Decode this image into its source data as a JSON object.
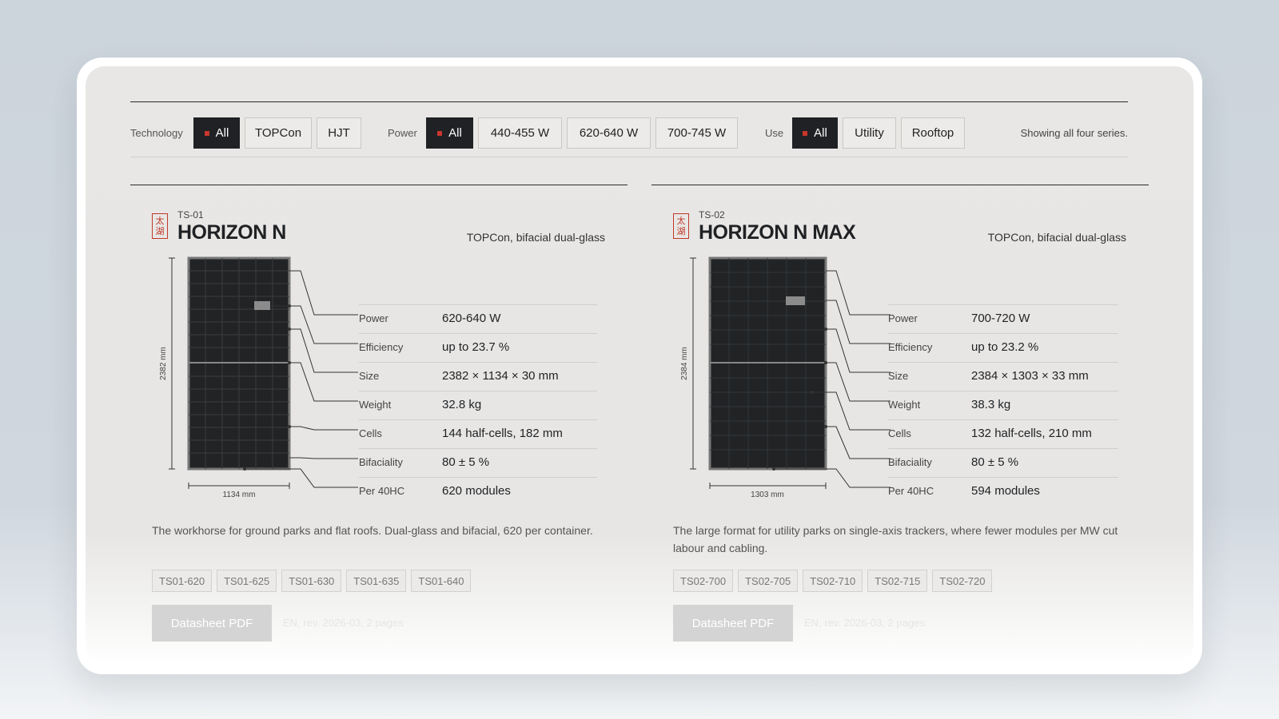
{
  "filters": {
    "technology": {
      "label": "Technology",
      "options": [
        "All",
        "TOPCon",
        "HJT"
      ],
      "active": "All"
    },
    "power": {
      "label": "Power",
      "options": [
        "All",
        "440-455 W",
        "620-640 W",
        "700-745 W"
      ],
      "active": "All"
    },
    "use": {
      "label": "Use",
      "options": [
        "All",
        "Utility",
        "Rooftop"
      ],
      "active": "All"
    },
    "status": "Showing all four series."
  },
  "accent_color": "#c9362c",
  "products": [
    {
      "seal": "太湖",
      "code": "TS-01",
      "name": "HORIZON N",
      "tech": "TOPCon, bifacial dual-glass",
      "height_label": "2382 mm",
      "width_label": "1134 mm",
      "specs": [
        {
          "label": "Power",
          "value": "620-640 W"
        },
        {
          "label": "Efficiency",
          "value": "up to 23.7 %"
        },
        {
          "label": "Size",
          "value": "2382 × 1134 × 30 mm"
        },
        {
          "label": "Weight",
          "value": "32.8 kg"
        },
        {
          "label": "Cells",
          "value": "144 half-cells, 182 mm"
        },
        {
          "label": "Bifaciality",
          "value": "80 ± 5 %"
        },
        {
          "label": "Per 40HC",
          "value": "620 modules"
        }
      ],
      "description": "The workhorse for ground parks and flat roofs. Dual-glass and bifacial, 620 per container.",
      "variants": [
        "TS01-620",
        "TS01-625",
        "TS01-630",
        "TS01-635",
        "TS01-640"
      ],
      "datasheet_label": "Datasheet PDF",
      "datasheet_meta": "EN, rev. 2026-03, 2 pages"
    },
    {
      "seal": "太湖",
      "code": "TS-02",
      "name": "HORIZON N MAX",
      "tech": "TOPCon, bifacial dual-glass",
      "height_label": "2384 mm",
      "width_label": "1303 mm",
      "specs": [
        {
          "label": "Power",
          "value": "700-720 W"
        },
        {
          "label": "Efficiency",
          "value": "up to 23.2 %"
        },
        {
          "label": "Size",
          "value": "2384 × 1303 × 33 mm"
        },
        {
          "label": "Weight",
          "value": "38.3 kg"
        },
        {
          "label": "Cells",
          "value": "132 half-cells, 210 mm"
        },
        {
          "label": "Bifaciality",
          "value": "80 ± 5 %"
        },
        {
          "label": "Per 40HC",
          "value": "594 modules"
        }
      ],
      "description": "The large format for utility parks on single-axis trackers, where fewer modules per MW cut labour and cabling.",
      "variants": [
        "TS02-700",
        "TS02-705",
        "TS02-710",
        "TS02-715",
        "TS02-720"
      ],
      "datasheet_label": "Datasheet PDF",
      "datasheet_meta": "EN, rev. 2026-03, 2 pages"
    }
  ]
}
